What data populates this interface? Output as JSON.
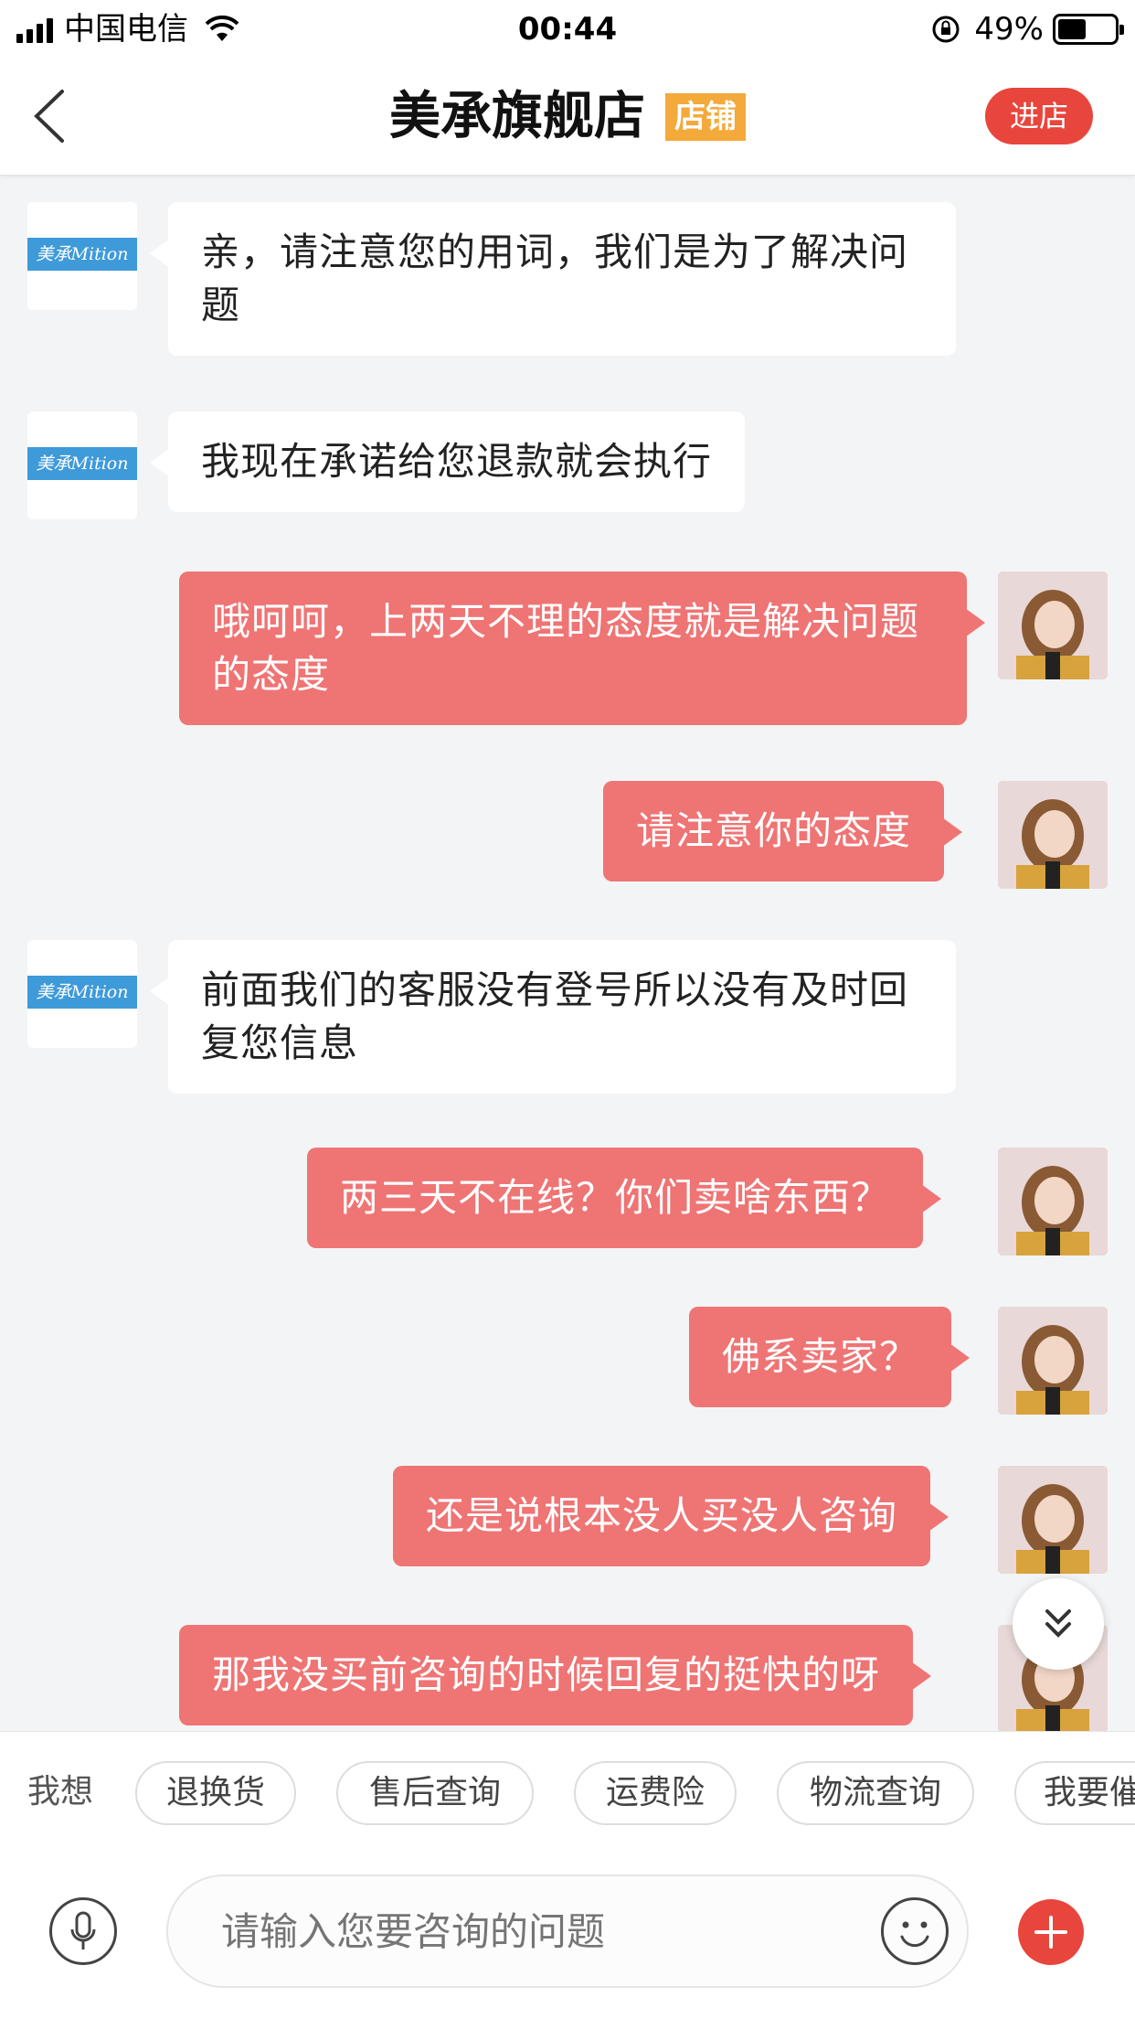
{
  "status_bar": {
    "carrier": "中国电信",
    "time": "00:44",
    "battery": "49%",
    "battery_level": 0.49
  },
  "header": {
    "title": "美承旗舰店",
    "badge": "店铺",
    "enter_button": "进店",
    "badge_color": "#f4a93b",
    "accent_color": "#e8453c"
  },
  "shop_avatar_logo": "美承Mition",
  "messages": [
    {
      "side": "left",
      "text": "亲，请注意您的用词，我们是为了解决问题"
    },
    {
      "side": "left",
      "text": "我现在承诺给您退款就会执行"
    },
    {
      "side": "right",
      "text": "哦呵呵，上两天不理的态度就是解决问题的态度"
    },
    {
      "side": "right",
      "text": "请注意你的态度"
    },
    {
      "side": "left",
      "text": "前面我们的客服没有登号所以没有及时回复您信息"
    },
    {
      "side": "right",
      "text": "两三天不在线？你们卖啥东西？"
    },
    {
      "side": "right",
      "text": "佛系卖家？"
    },
    {
      "side": "right",
      "text": "还是说根本没人买没人咨询"
    },
    {
      "side": "right",
      "text": "那我没买前咨询的时候回复的挺快的呀"
    }
  ],
  "quick_replies": {
    "label": "我想",
    "chips": [
      "退换货",
      "售后查询",
      "运费险",
      "物流查询",
      "我要催"
    ]
  },
  "input": {
    "placeholder": "请输入您要咨询的问题"
  },
  "icons": {
    "back": "chevron-left-icon",
    "scroll_down": "double-chevron-down-icon",
    "mic": "microphone-icon",
    "emoji": "smiley-icon",
    "plus": "plus-icon"
  },
  "colors": {
    "user_bubble": "#ef7474",
    "shop_bubble": "#ffffff",
    "background": "#f3f4f6"
  }
}
